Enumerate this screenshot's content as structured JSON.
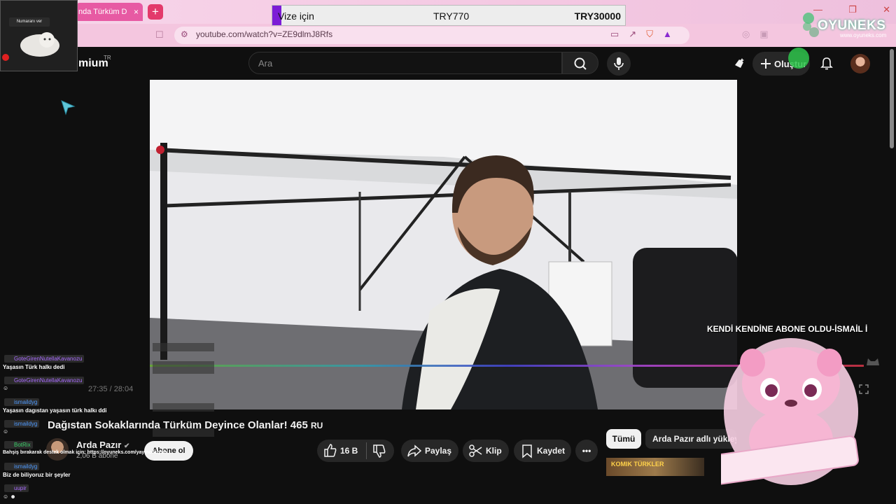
{
  "browser": {
    "tab_title": "nda Türküm D",
    "tab_close": "×",
    "new_tab": "+",
    "url": "youtube.com/watch?v=ZE9dlmJ8Rfs",
    "window_controls": [
      "—",
      "❐",
      "✕"
    ]
  },
  "donation_bar": {
    "label": "Vize için",
    "current": "TRY770",
    "goal": "TRY30000",
    "progress": 0.026
  },
  "sponsor": {
    "name": "OYUNEKS",
    "url": "www.oyuneks.com"
  },
  "webcam": {
    "label": "Numaranı ver"
  },
  "youtube": {
    "logo_text": "mium",
    "logo_region": "TR",
    "search_placeholder": "Ara",
    "create_label": "Oluştur"
  },
  "video": {
    "time": "27:35 / 28:04",
    "title": "Dağıstan Sokaklarında Türküm Deyince Olanlar! 465",
    "title_suffix": "RU",
    "channel": "Arda Pazır",
    "subscribers": "2,06 B abone",
    "subscribe_label": "Abone ol",
    "likes": "16 B",
    "share_label": "Paylaş",
    "clip_label": "Klip",
    "save_label": "Kaydet"
  },
  "sidebar_chips": {
    "all": "Tümü",
    "uploads": "Arda Pazır adlı yükleyi"
  },
  "recommendation": {
    "thumb_text": "KOMIK TÜRKLER"
  },
  "overlay": {
    "sub_alert": "KENDİ KENDİNE ABONE OLDU-İSMAİL İ"
  },
  "chat": [
    {
      "user": "GoteGirenNutellaKavanozu",
      "message": "Yaşasın Türk halkı dedi",
      "color": "purple"
    },
    {
      "user": "GoteGirenNutellaKavanozu",
      "message": "",
      "color": "purple"
    },
    {
      "user": "ismaildyg",
      "message": "Yaşasın dagıstan yaşasın türk halkı ddi",
      "color": "blue"
    },
    {
      "user": "ismaildyg",
      "message": "",
      "color": "blue"
    },
    {
      "user": "BotRix",
      "message": "Bahşiş bırakarak destek olmak için: https://oyuneks.com/yayinci/clytie_...",
      "color": "green"
    },
    {
      "user": "ismaildyg",
      "message": "Biz de biliyoruz bir şeyler",
      "color": "blue"
    },
    {
      "user": "uupir",
      "message": "",
      "color": "purple"
    }
  ]
}
